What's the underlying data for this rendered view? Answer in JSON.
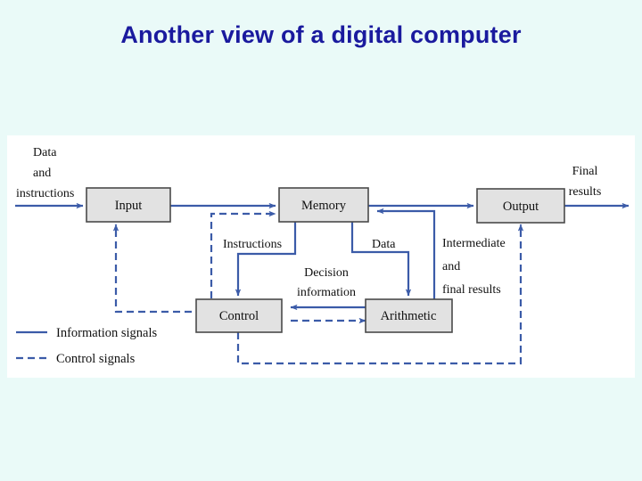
{
  "slide": {
    "title": "Another view of a digital computer",
    "background_color": "#eafaf8",
    "title_color": "#1a1a9e"
  },
  "figure": {
    "background_color": "#ffffff",
    "line_color": "#3b5ba8",
    "box_fill": "#e2e2e2",
    "box_border": "#4a4a4a",
    "boxes": [
      {
        "id": "input",
        "label": "Input"
      },
      {
        "id": "memory",
        "label": "Memory"
      },
      {
        "id": "output",
        "label": "Output"
      },
      {
        "id": "control",
        "label": "Control"
      },
      {
        "id": "arithmetic",
        "label": "Arithmetic"
      }
    ],
    "annotations": [
      {
        "id": "data-and-instructions",
        "lines": [
          "Data",
          "and",
          "instructions"
        ]
      },
      {
        "id": "final-results",
        "lines": [
          "Final",
          "results"
        ]
      },
      {
        "id": "instructions",
        "lines": [
          "Instructions"
        ]
      },
      {
        "id": "data",
        "lines": [
          "Data"
        ]
      },
      {
        "id": "decision-information",
        "lines": [
          "Decision",
          "information"
        ]
      },
      {
        "id": "intermediate-and-final-results",
        "lines": [
          "Intermediate",
          "and",
          "final results"
        ]
      }
    ],
    "annotation_text": {
      "data_and_instructions_1": "Data",
      "data_and_instructions_2": "and",
      "data_and_instructions_3": "instructions",
      "final_results_1": "Final",
      "final_results_2": "results",
      "instructions": "Instructions",
      "data": "Data",
      "decision_1": "Decision",
      "decision_2": "information",
      "intermediate_1": "Intermediate",
      "intermediate_2": "and",
      "intermediate_3": "final results"
    },
    "legend": {
      "items": [
        {
          "id": "information-signals",
          "label": "Information signals",
          "style": "solid"
        },
        {
          "id": "control-signals",
          "label": "Control signals",
          "style": "dashed"
        }
      ]
    }
  }
}
